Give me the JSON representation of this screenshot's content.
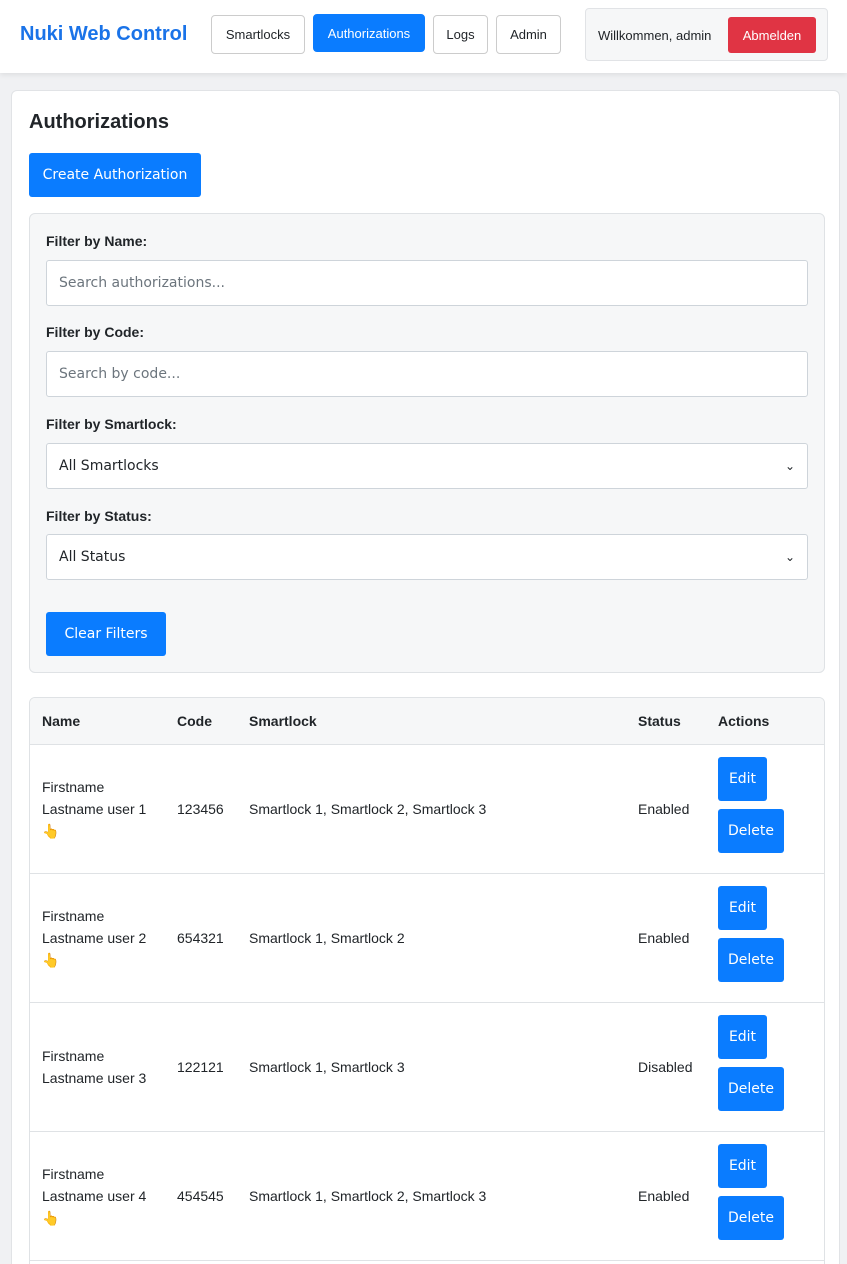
{
  "nav": {
    "brand": "Nuki Web Control",
    "items": [
      {
        "label": "Smartlocks",
        "active": false
      },
      {
        "label": "Authorizations",
        "active": true
      },
      {
        "label": "Logs",
        "active": false
      },
      {
        "label": "Admin",
        "active": false
      }
    ],
    "welcome": "Willkommen, admin",
    "logout_label": "Abmelden"
  },
  "page": {
    "title": "Authorizations",
    "create_label": "Create Authorization"
  },
  "filters": {
    "name_label": "Filter by Name:",
    "name_placeholder": "Search authorizations...",
    "code_label": "Filter by Code:",
    "code_placeholder": "Search by code...",
    "smartlock_label": "Filter by Smartlock:",
    "smartlock_value": "All Smartlocks",
    "status_label": "Filter by Status:",
    "status_value": "All Status",
    "clear_label": "Clear Filters"
  },
  "table": {
    "headers": [
      "Name",
      "Code",
      "Smartlock",
      "Status",
      "Actions"
    ],
    "edit_label": "Edit",
    "delete_label": "Delete",
    "rows": [
      {
        "name1": "Firstname",
        "name2": "Lastname user 1",
        "icon": "👆",
        "code": "123456",
        "smartlocks": "Smartlock 1, Smartlock 2, Smartlock 3",
        "status": "Enabled"
      },
      {
        "name1": "Firstname",
        "name2": "Lastname user 2",
        "icon": "👆",
        "code": "654321",
        "smartlocks": "Smartlock 1, Smartlock 2",
        "status": "Enabled"
      },
      {
        "name1": "Firstname",
        "name2": "Lastname user 3",
        "icon": "",
        "code": "122121",
        "smartlocks": "Smartlock 1, Smartlock 3",
        "status": "Disabled"
      },
      {
        "name1": "Firstname",
        "name2": "Lastname user 4",
        "icon": "👆",
        "code": "454545",
        "smartlocks": "Smartlock 1, Smartlock 2, Smartlock 3",
        "status": "Enabled"
      }
    ]
  }
}
